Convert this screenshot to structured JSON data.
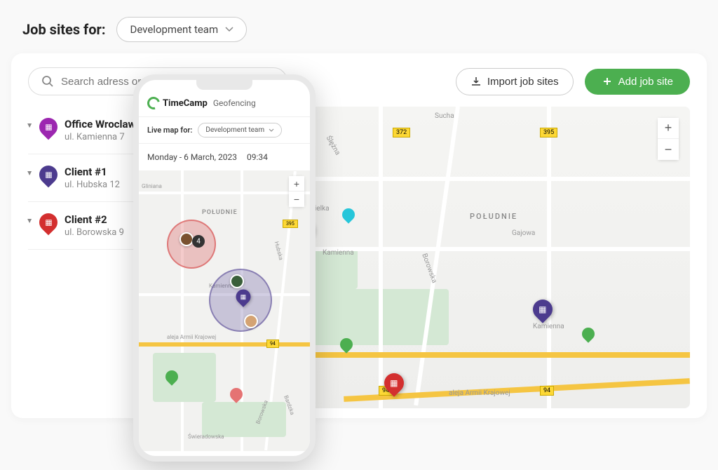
{
  "header": {
    "label": "Job sites for:",
    "team": "Development team"
  },
  "search": {
    "placeholder": "Search adress or job site name"
  },
  "importBtn": "Import job sites",
  "addBtn": "Add job site",
  "sites": [
    {
      "name": "Office Wroclaw",
      "addr": "ul. Kamienna 7",
      "color": "purple"
    },
    {
      "name": "Client #1",
      "addr": "ul. Hubska 12",
      "color": "indigo"
    },
    {
      "name": "Client #2",
      "addr": "ul. Borowska 9",
      "color": "red"
    }
  ],
  "map": {
    "district": "POŁUDNIE",
    "streets": [
      "Sucha",
      "Gliniana",
      "Wielka",
      "Kamienna",
      "Borowska",
      "Gajowa",
      "aleja Armii Krajowej",
      "Ślężna"
    ],
    "routes": [
      "372",
      "395",
      "94"
    ]
  },
  "mobile": {
    "brand": "TimeCamp",
    "feature": "Geofencing",
    "liveMapLabel": "Live map for:",
    "team": "Development team",
    "date": "Monday - 6 March, 2023",
    "time": "09:34",
    "district": "POŁUDNIE",
    "streets": [
      "Gliniana",
      "Kamienna",
      "aleja Armii Krajowej",
      "Hubska",
      "Świeradowska",
      "Borowska",
      "Bardzka"
    ],
    "routes": [
      "395",
      "94"
    ],
    "memberCount": "4"
  }
}
